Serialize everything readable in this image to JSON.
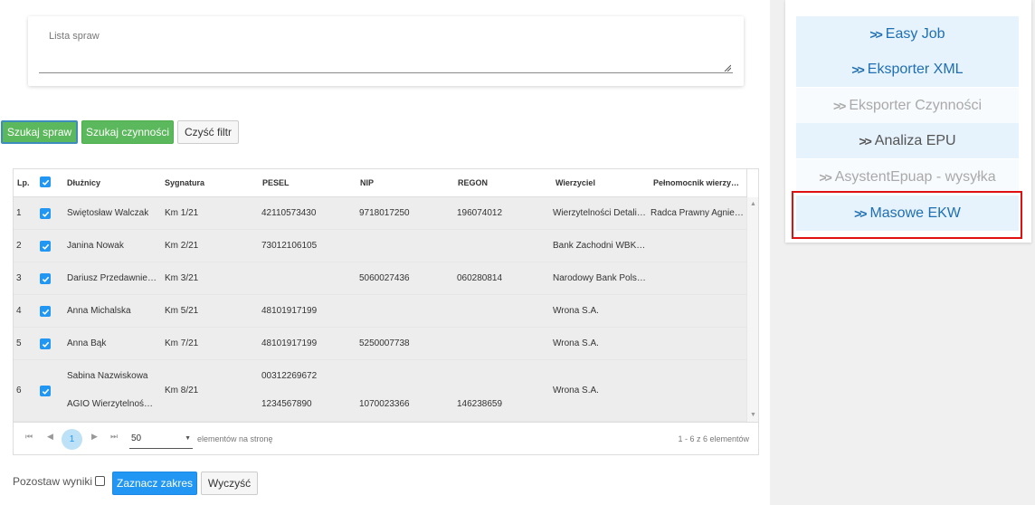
{
  "lista": {
    "label": "Lista spraw"
  },
  "buttons": {
    "szukaj_spraw": "Szukaj spraw",
    "szukaj_czynnosci": "Szukaj czynności",
    "czysc_filtr": "Czyść filtr",
    "zaznacz_zakres": "Zaznacz zakres",
    "wyczysc": "Wyczyść"
  },
  "grid": {
    "columns": [
      "Lp.",
      "",
      "Dłużnicy",
      "Sygnatura",
      "PESEL",
      "NIP",
      "REGON",
      "Wierzyciel",
      "Pełnomocnik wierzyci..."
    ],
    "rows": [
      {
        "lp": "1",
        "dluznik": "Świętosław Walczak",
        "sygnatura": "Km 1/21",
        "pesel": "42110573430",
        "nip": "9718017250",
        "regon": "196074012",
        "wierzyciel": "Wierzytelności Detalic...",
        "pelnomocnik": "Radca Prawny Agnies..."
      },
      {
        "lp": "2",
        "dluznik": "Janina Nowak",
        "sygnatura": "Km 2/21",
        "pesel": "73012106105",
        "nip": "",
        "regon": "",
        "wierzyciel": "Bank Zachodni WBK SA",
        "pelnomocnik": ""
      },
      {
        "lp": "3",
        "dluznik": "Dariusz Przedawnienie",
        "sygnatura": "Km 3/21",
        "pesel": "",
        "nip": "5060027436",
        "regon": "060280814",
        "wierzyciel": "Narodowy Bank Polski...",
        "pelnomocnik": ""
      },
      {
        "lp": "4",
        "dluznik": "Anna Michalska",
        "sygnatura": "Km 5/21",
        "pesel": "48101917199",
        "nip": "",
        "regon": "",
        "wierzyciel": "Wrona S.A.",
        "pelnomocnik": ""
      },
      {
        "lp": "5",
        "dluznik": "Anna Bąk",
        "sygnatura": "Km 7/21",
        "pesel": "48101917199",
        "nip": "5250007738",
        "regon": "",
        "wierzyciel": "Wrona S.A.",
        "pelnomocnik": ""
      },
      {
        "lp": "6",
        "dluznik": "Sabina Nazwiskowa",
        "dluznik2": "AGIO Wierzytelności ...",
        "sygnatura": "Km 8/21",
        "pesel": "00312269672",
        "pesel2": "1234567890",
        "nip": "",
        "nip2": "1070023366",
        "regon": "",
        "regon2": "146238659",
        "wierzyciel": "Wrona S.A.",
        "pelnomocnik": ""
      }
    ]
  },
  "pager": {
    "first": "⏮",
    "prev": "◀",
    "current": "1",
    "next": "▶",
    "last": "⏭",
    "page_size": "50",
    "page_size_label": "elementów na stronę",
    "info": "1 - 6 z 6 elementów"
  },
  "pozostaw": "Pozostaw wyniki",
  "side_menu": [
    {
      "label": "Easy Job",
      "state": "active"
    },
    {
      "label": "Eksporter XML",
      "state": "active"
    },
    {
      "label": "Eksporter Czynności",
      "state": "disabled"
    },
    {
      "label": "Analiza EPU",
      "state": "dark"
    },
    {
      "label": "AsystentEpuap - wysyłka",
      "state": "disabled"
    },
    {
      "label": "Masowe EKW",
      "state": "active"
    }
  ],
  "colors": {
    "accent": "#2196f3",
    "green": "#5cb85c",
    "highlight": "#e01010"
  }
}
